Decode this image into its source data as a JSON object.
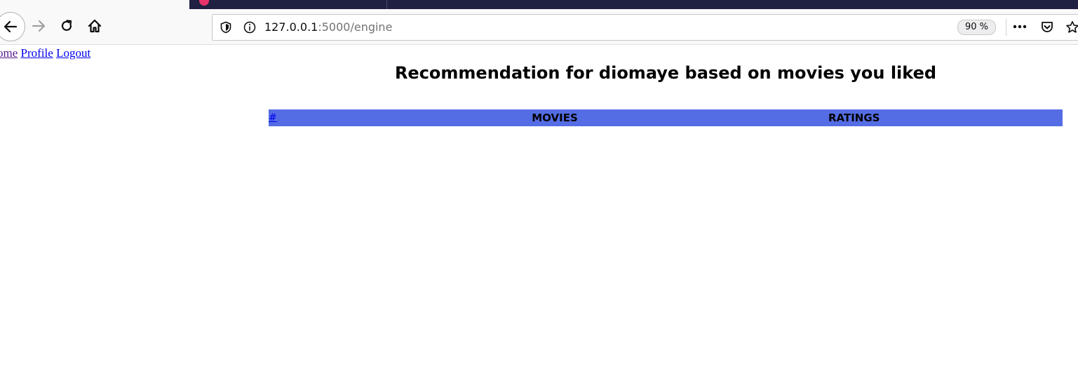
{
  "browser": {
    "url_host": "127.0.0.1",
    "url_path": ":5000/engine",
    "zoom": "90 %"
  },
  "nav_links": {
    "home": "ome",
    "profile": "Profile",
    "logout": "Logout"
  },
  "page": {
    "title": "Recommendation for diomaye based on movies you liked"
  },
  "table": {
    "headers": {
      "index": "#",
      "movies": "MOVIES",
      "ratings": "RATINGS"
    },
    "rows": []
  },
  "colors": {
    "table_header_bg": "#546de5",
    "tab_strip_bg": "#1f2042"
  },
  "icons": [
    "back-arrow-icon",
    "forward-arrow-icon",
    "reload-icon",
    "home-icon",
    "tracking-shield-icon",
    "site-info-icon",
    "page-actions-icon",
    "pocket-icon",
    "bookmark-star-icon"
  ]
}
